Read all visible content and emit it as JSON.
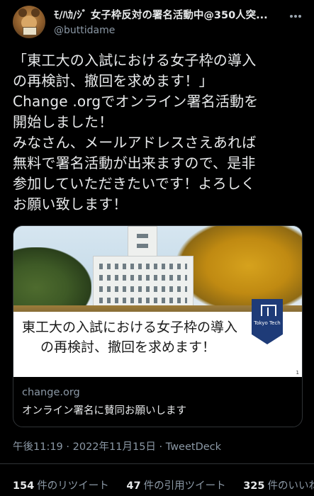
{
  "author": {
    "display_name": "ﾓ/ﾊｶ/ｼﾞ 女子枠反対の署名活動中@350人突...",
    "handle": "@buttidame"
  },
  "tweet": {
    "lines": [
      "「東工大の入試における女子枠の導入",
      "の再検討、撤回を求めます！」",
      "Change .orgでオンライン署名活動を",
      "開始しました！",
      "みなさん、メールアドレスさえあれば",
      "無料で署名活動が出来ますので、是非",
      "参加していただきたいです！よろしく",
      "お願い致します！"
    ]
  },
  "card": {
    "banner_line1": "東工大の入試における女子枠の導入",
    "banner_line2": "の再検討、撤回を求めます！",
    "logo_label": "Tokyo Tech",
    "corner_number": "1",
    "domain": "change.org",
    "title": "オンライン署名に賛同お願いします"
  },
  "timestamp": "午後11:19 · 2022年11月15日 · TweetDeck",
  "stats": [
    {
      "count": "154",
      "label": "件のリツイート"
    },
    {
      "count": "47",
      "label": "件の引用ツイート"
    },
    {
      "count": "325",
      "label": "件のいいね"
    }
  ],
  "icons": {
    "avatar": "squirrel-avatar",
    "more": "more-options-icon"
  }
}
